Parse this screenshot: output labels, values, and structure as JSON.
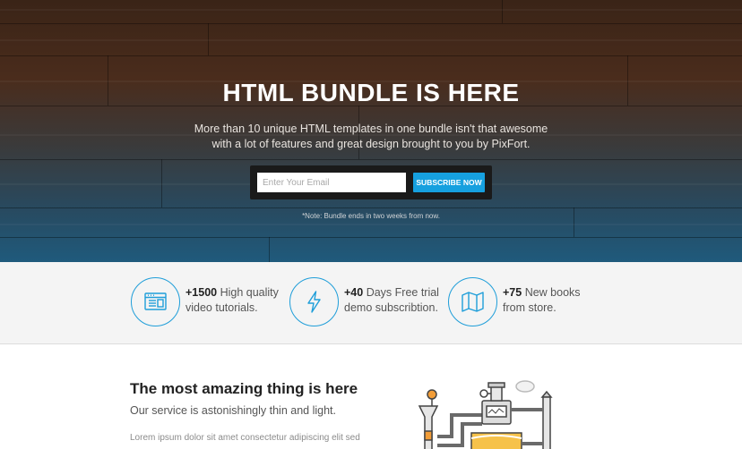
{
  "hero": {
    "title": "HTML BUNDLE IS HERE",
    "subtitle_line1": "More than 10 unique HTML templates in one bundle isn't that awesome",
    "subtitle_line2": "with a lot of features and great design brought to you by PixFort.",
    "email_placeholder": "Enter Your Email",
    "subscribe_label": "SUBSCRIBE NOW",
    "note": "*Note: Bundle ends in two weeks from now."
  },
  "features": [
    {
      "icon": "browser-window-icon",
      "count": "+1500",
      "text_line1": " High quality",
      "text_line2": "video tutorials."
    },
    {
      "icon": "lightning-bolt-icon",
      "count": "+40",
      "text_line1": " Days Free trial",
      "text_line2": "demo subscribtion."
    },
    {
      "icon": "map-icon",
      "count": "+75",
      "text_line1": " New books",
      "text_line2": "from store."
    }
  ],
  "content": {
    "title": "The most amazing thing is here",
    "subtitle": "Our service is astonishingly thin and light.",
    "lorem": "Lorem ipsum dolor sit amet consectetur adipiscing elit sed"
  },
  "colors": {
    "accent": "#16a0df",
    "icon_stroke": "#1f9ed9"
  }
}
